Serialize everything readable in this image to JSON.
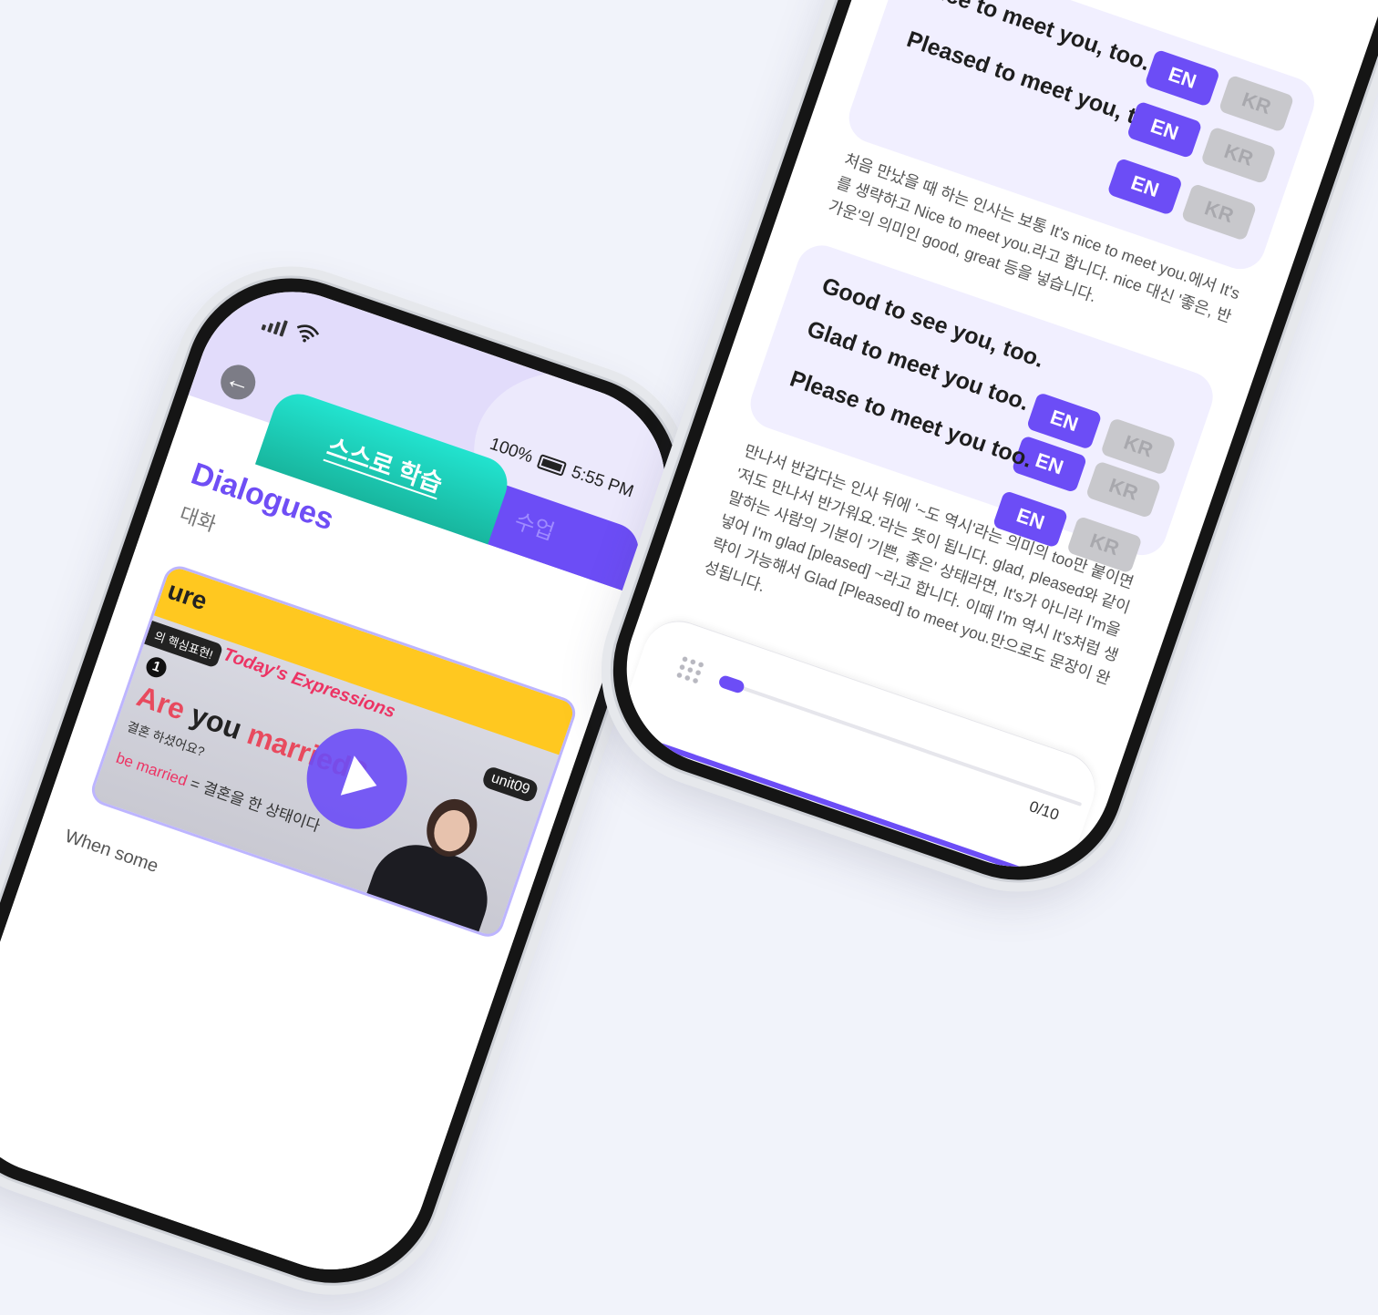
{
  "left_phone": {
    "status": {
      "battery": "100%",
      "time": "5:55 PM"
    },
    "tabs": {
      "active": "스스로 학습",
      "inactive": "수업"
    },
    "title": "Dialogues",
    "subtitle": "대화",
    "video": {
      "banner": "ure",
      "tag": "의 핵심표현!",
      "heading": "Today's Expressions",
      "unit": "unit09",
      "number": "1",
      "question_a": "Are",
      "question_b": "you",
      "question_c": "married?",
      "korean": "결혼 하셨어요?",
      "def_en": "be married",
      "def_rest": "= 결혼을 한 상태이다"
    },
    "lower_text": "When some"
  },
  "right_phone": {
    "card1": {
      "rows": [
        {
          "line": "Nice to meet you, too.",
          "en": "EN",
          "kr": "KR"
        },
        {
          "line": "Pleased to meet you, too.",
          "en": "EN",
          "kr": "KR"
        },
        {
          "line": "",
          "en": "EN",
          "kr": "KR"
        }
      ]
    },
    "explain1": "처음 만났을 때 하는 인사는 보통 It's nice to meet you.에서 It's를 생략하고 Nice to meet you.라고 합니다. nice 대신 '좋은, 반가운'의 의미인 good, great 등을 넣습니다.",
    "card2": {
      "rows": [
        {
          "line": "Good to see you, too.",
          "en": "EN",
          "kr": "KR"
        },
        {
          "line": "Glad to meet you too.",
          "en": "EN",
          "kr": "KR"
        },
        {
          "line": "Please to meet you too.",
          "en": "EN",
          "kr": "KR"
        }
      ]
    },
    "explain2": "만나서 반갑다는 인사 뒤에 '~도 역시'라는 의미의 too만 붙이면 '저도 만나서 반가워요.'라는 뜻이 됩니다. glad, pleased와 같이 말하는 사람의 기분이 '기쁜, 좋은' 상태라면, It's가 아니라 I'm을 넣어 I'm glad [pleased] ~라고 합니다. 이때 I'm 역시 It's처럼 생략이 가능해서 Glad [Pleased] to meet you.만으로도 문장이 완성됩니다.",
    "progress": {
      "label": "0/10",
      "fraction": 0.05
    }
  },
  "colors": {
    "accent": "#6c4df6",
    "teal": "#1fd6c0",
    "card": "#f1efff"
  }
}
